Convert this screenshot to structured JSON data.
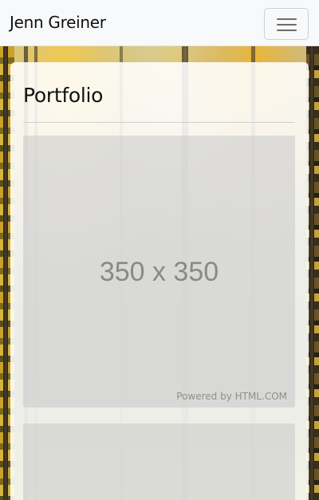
{
  "navbar": {
    "brand": "Jenn Greiner",
    "toggle_icon": "hamburger-menu-icon"
  },
  "main": {
    "heading": "Portfolio",
    "items": [
      {
        "size_label": "350 x 350",
        "credit": "Powered by HTML.COM"
      },
      {
        "size_label": "",
        "credit": ""
      }
    ]
  },
  "colors": {
    "navbar_bg": "#f8f9fa",
    "card_bg": "#ffffff",
    "placeholder_bg": "#cccccc",
    "text": "#111111"
  }
}
